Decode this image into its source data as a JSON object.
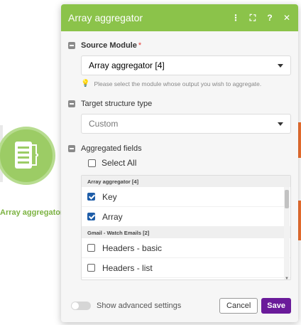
{
  "canvas": {
    "module_label": "Array aggregator"
  },
  "dialog": {
    "title": "Array aggregator",
    "header_icons": [
      "more-icon",
      "expand-icon",
      "help-icon",
      "close-icon"
    ],
    "header_icon_glyphs": [
      "⋮",
      "⛶",
      "?",
      "✕"
    ]
  },
  "source_module": {
    "label": "Source Module",
    "required_mark": "*",
    "value": "Array aggregator [4]",
    "hint": "Please select the module whose output you wish to aggregate."
  },
  "target_structure": {
    "label": "Target structure type",
    "value": "Custom"
  },
  "aggregated_fields": {
    "label": "Aggregated fields",
    "select_all_label": "Select All",
    "groups": [
      {
        "name": "Array aggregator [4]",
        "fields": [
          {
            "label": "Key",
            "checked": true
          },
          {
            "label": "Array",
            "checked": true
          }
        ]
      },
      {
        "name": "Gmail - Watch Emails [2]",
        "fields": [
          {
            "label": "Headers - basic",
            "checked": false
          },
          {
            "label": "Headers - list",
            "checked": false
          }
        ]
      }
    ]
  },
  "footer": {
    "advanced_label": "Show advanced settings",
    "advanced_on": false,
    "cancel_label": "Cancel",
    "save_label": "Save"
  },
  "colors": {
    "header_green": "#8bc34a",
    "save_purple": "#6a1b9a",
    "checkbox_blue": "#1e5da8"
  }
}
